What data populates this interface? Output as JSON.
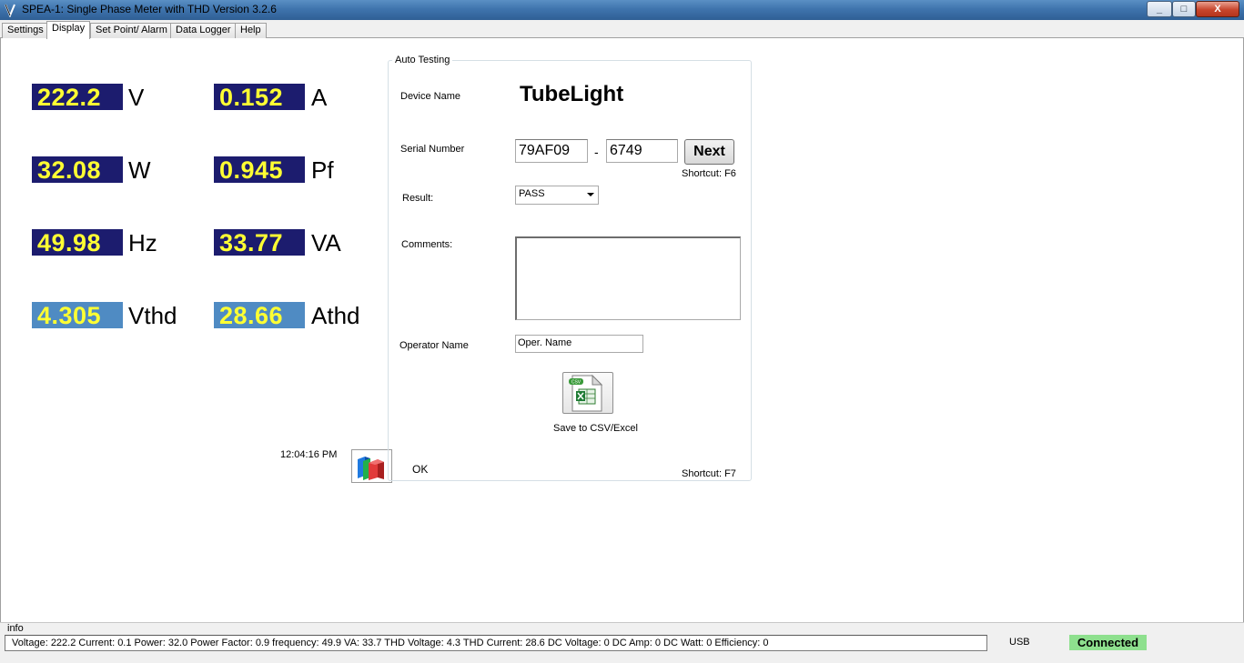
{
  "window": {
    "title": "SPEA-1: Single Phase Meter with THD Version 3.2.6",
    "minimize_glyph": "_",
    "maximize_glyph": "□",
    "close_glyph": "X"
  },
  "tabs": [
    {
      "label": "Settings",
      "active": false
    },
    {
      "label": "Display",
      "active": true
    },
    {
      "label": "Set Point/ Alarm",
      "active": false
    },
    {
      "label": "Data Logger",
      "active": false
    },
    {
      "label": "Help",
      "active": false
    }
  ],
  "readings": {
    "voltage": {
      "value": "222.2",
      "unit": "V"
    },
    "current": {
      "value": "0.152",
      "unit": "A"
    },
    "power": {
      "value": "32.08",
      "unit": "W"
    },
    "power_factor": {
      "value": "0.945",
      "unit": "Pf"
    },
    "frequency": {
      "value": "49.98",
      "unit": "Hz"
    },
    "va": {
      "value": "33.77",
      "unit": "VA"
    },
    "vthd": {
      "value": "4.305",
      "unit": "Vthd"
    },
    "athd": {
      "value": "28.66",
      "unit": "Athd"
    }
  },
  "clock": "12:04:16 PM",
  "ok_label": "OK",
  "auto_testing": {
    "title": "Auto Testing",
    "device_name_label": "Device Name",
    "device_name_value": "TubeLight",
    "serial_label": "Serial Number",
    "serial_part1": "79AF09",
    "serial_separator": "-",
    "serial_part2": "6749",
    "next_label": "Next",
    "next_shortcut": "Shortcut: F6",
    "result_label": "Result:",
    "result_value": "PASS",
    "comments_label": "Comments:",
    "operator_label": "Operator Name",
    "operator_value": "Oper. Name",
    "csv_badge": "CSV",
    "save_label": "Save to CSV/Excel",
    "save_shortcut": "Shortcut: F7"
  },
  "status": {
    "info_label": "info",
    "message": "Voltage: 222.2 Current: 0.1 Power: 32.0 Power Factor: 0.9 frequency: 49.9 VA: 33.7 THD Voltage: 4.3 THD Current: 28.6 DC Voltage: 0 DC Amp: 0 DC Watt: 0 Efficiency: 0",
    "port": "USB",
    "connection": "Connected"
  },
  "colors": {
    "meter_bg": "#1c1c6e",
    "thd_bg": "#4f8bc3",
    "meter_text": "#ffff33",
    "connected_bg": "#8ee08e"
  }
}
